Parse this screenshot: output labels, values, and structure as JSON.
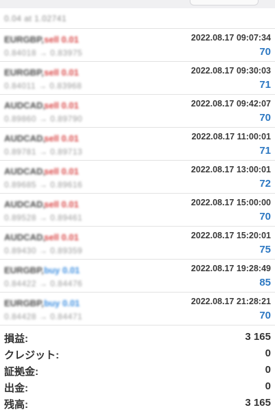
{
  "summary": {
    "text": "0.04 at 1.02741"
  },
  "trades": [
    {
      "symbol": "EURGBP,",
      "action": "sell 0.01",
      "side": "sell",
      "prices": "0.84018 → 0.83975",
      "datetime": "2022.08.17 09:07:34",
      "profit": "70"
    },
    {
      "symbol": "EURGBP,",
      "action": "sell 0.01",
      "side": "sell",
      "prices": "0.84011 → 0.83968",
      "datetime": "2022.08.17 09:30:03",
      "profit": "71"
    },
    {
      "symbol": "AUDCAD,",
      "action": "sell 0.01",
      "side": "sell",
      "prices": "0.89860 → 0.89790",
      "datetime": "2022.08.17 09:42:07",
      "profit": "70"
    },
    {
      "symbol": "AUDCAD,",
      "action": "sell 0.01",
      "side": "sell",
      "prices": "0.89781 → 0.89713",
      "datetime": "2022.08.17 11:00:01",
      "profit": "71"
    },
    {
      "symbol": "AUDCAD,",
      "action": "sell 0.01",
      "side": "sell",
      "prices": "0.89685 → 0.89616",
      "datetime": "2022.08.17 13:00:01",
      "profit": "72"
    },
    {
      "symbol": "AUDCAD,",
      "action": "sell 0.01",
      "side": "sell",
      "prices": "0.89528 → 0.89461",
      "datetime": "2022.08.17 15:00:00",
      "profit": "70"
    },
    {
      "symbol": "AUDCAD,",
      "action": "sell 0.01",
      "side": "sell",
      "prices": "0.89430 → 0.89359",
      "datetime": "2022.08.17 15:20:01",
      "profit": "75"
    },
    {
      "symbol": "EURGBP,",
      "action": "buy 0.01",
      "side": "buy",
      "prices": "0.84422 → 0.84476",
      "datetime": "2022.08.17 19:28:49",
      "profit": "85"
    },
    {
      "symbol": "EURGBP,",
      "action": "buy 0.01",
      "side": "buy",
      "prices": "0.84428 → 0.84471",
      "datetime": "2022.08.17 21:28:21",
      "profit": "70"
    }
  ],
  "totals": {
    "profit_label": "損益:",
    "profit_value": "3 165",
    "credit_label": "クレジット:",
    "credit_value": "0",
    "deposit_label": "証拠金:",
    "deposit_value": "0",
    "withdrawal_label": "出金:",
    "withdrawal_value": "0",
    "balance_label": "残高:",
    "balance_value": "3 165"
  },
  "colors": {
    "sell": "#d94545",
    "buy": "#3a8de0",
    "profit": "#2d78c2"
  }
}
